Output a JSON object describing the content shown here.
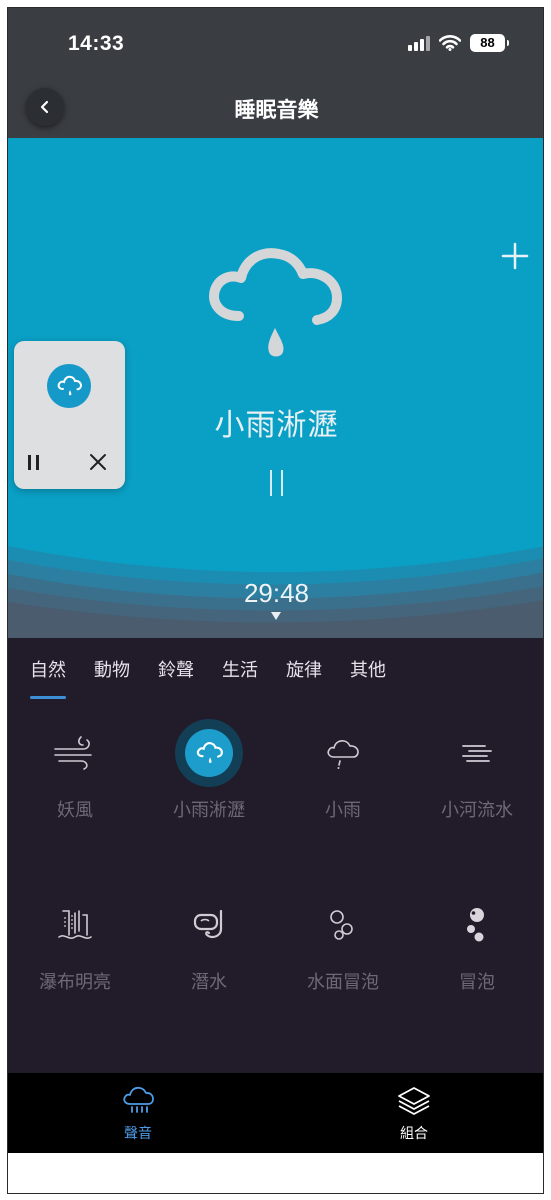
{
  "status": {
    "time": "14:33",
    "battery": "88"
  },
  "header": {
    "title": "睡眠音樂"
  },
  "hero": {
    "sound_name": "小雨淅瀝",
    "timer": "29:48",
    "background": "#0aa0c6"
  },
  "tabs": [
    {
      "label": "自然",
      "active": true
    },
    {
      "label": "動物"
    },
    {
      "label": "鈴聲"
    },
    {
      "label": "生活"
    },
    {
      "label": "旋律"
    },
    {
      "label": "其他"
    }
  ],
  "sounds": [
    {
      "label": "妖風",
      "icon": "wind-icon"
    },
    {
      "label": "小雨淅瀝",
      "icon": "rain-cloud-icon",
      "selected": true
    },
    {
      "label": "小雨",
      "icon": "light-rain-icon"
    },
    {
      "label": "小河流水",
      "icon": "river-icon"
    },
    {
      "label": "瀑布明亮",
      "icon": "waterfall-icon"
    },
    {
      "label": "潛水",
      "icon": "diving-mask-icon"
    },
    {
      "label": "水面冒泡",
      "icon": "surface-bubbles-icon"
    },
    {
      "label": "冒泡",
      "icon": "bubbles-icon"
    }
  ],
  "bottom_nav": [
    {
      "label": "聲音",
      "icon": "rain-cloud-icon",
      "active": true,
      "color": "#4f9be6"
    },
    {
      "label": "組合",
      "icon": "layers-icon",
      "color": "#ffffff"
    }
  ],
  "colors": {
    "accent": "#3b8fd6",
    "panel": "#221b29",
    "muted_label": "#6e6876"
  }
}
